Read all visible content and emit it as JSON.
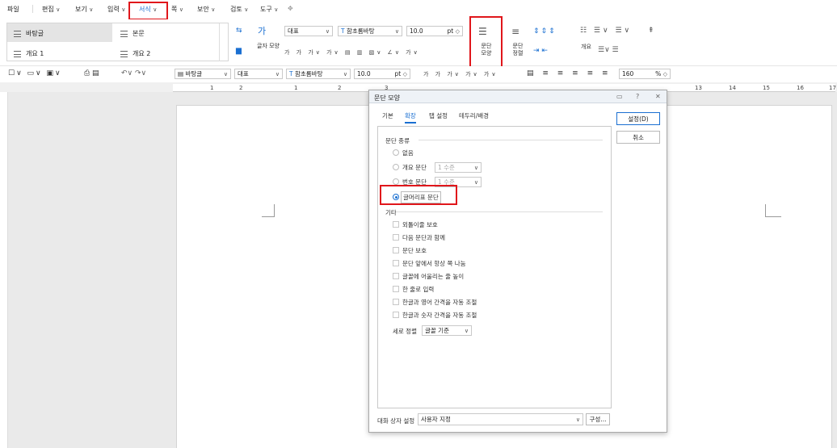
{
  "menu": {
    "items": [
      "파일",
      "편집",
      "보기",
      "입력",
      "서식",
      "쪽",
      "보안",
      "검토",
      "도구"
    ],
    "active": "서식"
  },
  "ribbon": {
    "styles": [
      "바탕글",
      "본문",
      "개요 1",
      "개요 2"
    ],
    "letter_label": "글자 모양",
    "style_dd": "대표",
    "font_dd": "함초롬바탕",
    "size_dd": "10.0",
    "size_unit": "pt",
    "para_shape_label": "문단 모양",
    "para_align_label": "문단 정렬",
    "outline_label": "개요"
  },
  "toolbar2": {
    "style_dd": "바탕글",
    "lang_dd": "대표",
    "font_dd": "함초롬바탕",
    "size_dd": "10.0",
    "size_unit": "pt",
    "zoom": "160",
    "zoom_unit": "%"
  },
  "ruler": {
    "ticks": [
      "1",
      "2",
      "1",
      "2",
      "3",
      "13",
      "14",
      "15",
      "16",
      "17"
    ]
  },
  "dialog": {
    "title": "문단 모양",
    "tabs": [
      "기본",
      "확장",
      "탭 설정",
      "테두리/배경"
    ],
    "active_tab": "확장",
    "group_paragraph_type": "문단 종류",
    "radios": [
      {
        "label": "없음",
        "selected": false
      },
      {
        "label": "개요 문단",
        "selected": false,
        "dd": "1 수준"
      },
      {
        "label": "번호 문단",
        "selected": false,
        "dd": "1 수준"
      },
      {
        "label": "글머리표 문단",
        "selected": true
      }
    ],
    "group_etc": "기타",
    "checks": [
      "외톨이줄 보호",
      "다음 문단과 함께",
      "문단 보호",
      "문단 앞에서 항상 쪽 나눔",
      "글꼴에 어울리는 줄 높이",
      "한 줄로 입력",
      "한글과 영어 간격을 자동 조절",
      "한글과 숫자 간격을 자동 조절"
    ],
    "vertical_align_label": "세로 정렬",
    "vertical_align_value": "글꼴 기준",
    "target_label": "대화 상자 설정",
    "target_value": "사용자 지정",
    "compose_button": "구성...",
    "ok_button": "설정(D)",
    "cancel_button": "취소"
  }
}
